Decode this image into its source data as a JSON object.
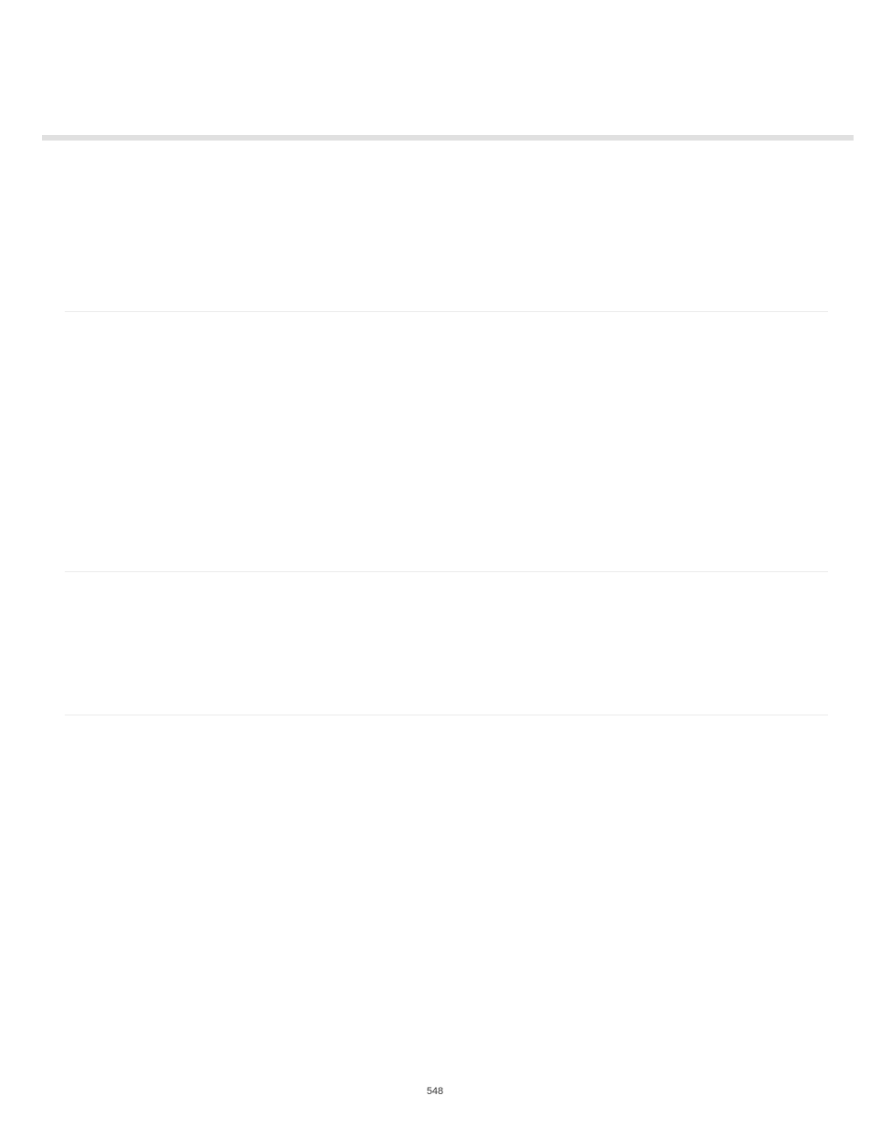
{
  "page_number": "548"
}
